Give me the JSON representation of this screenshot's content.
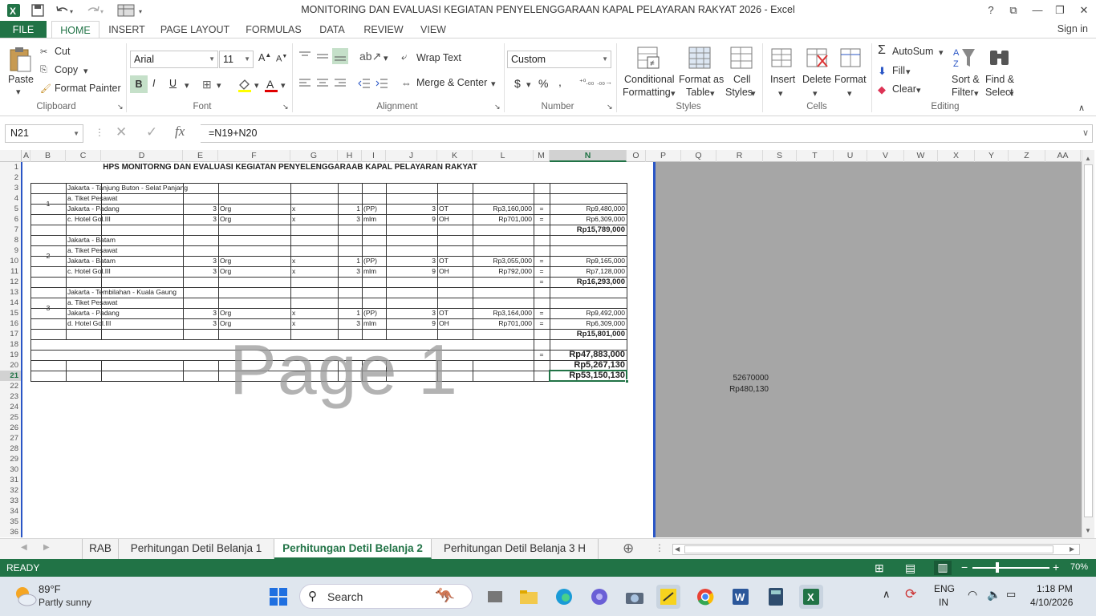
{
  "window": {
    "title": "MONITORING DAN EVALUASI KEGIATAN PENYELENGGARAAN KAPAL PELAYARAN RAKYAT 2026 - Excel",
    "help": "?",
    "signin": "Sign in"
  },
  "ribbon_tabs": [
    "FILE",
    "HOME",
    "INSERT",
    "PAGE LAYOUT",
    "FORMULAS",
    "DATA",
    "REVIEW",
    "VIEW"
  ],
  "ribbon": {
    "clipboard": {
      "paste": "Paste",
      "cut": "Cut",
      "copy": "Copy",
      "format_painter": "Format Painter",
      "label": "Clipboard"
    },
    "font": {
      "name": "Arial",
      "size": "11",
      "bold": "B",
      "italic": "I",
      "underline": "U",
      "label": "Font"
    },
    "alignment": {
      "wrap": "Wrap Text",
      "merge": "Merge & Center",
      "label": "Alignment"
    },
    "number": {
      "format": "Custom",
      "currency": "$",
      "percent": "%",
      "comma": ",",
      "label": "Number"
    },
    "styles": {
      "conditional_1": "Conditional",
      "conditional_2": "Formatting",
      "format_table_1": "Format as",
      "format_table_2": "Table",
      "cell_styles_1": "Cell",
      "cell_styles_2": "Styles",
      "label": "Styles"
    },
    "cells": {
      "insert": "Insert",
      "delete": "Delete",
      "format": "Format",
      "label": "Cells"
    },
    "editing": {
      "autosum": "AutoSum",
      "fill": "Fill",
      "clear": "Clear",
      "sort_1": "Sort &",
      "sort_2": "Filter",
      "find_1": "Find &",
      "find_2": "Select",
      "label": "Editing"
    }
  },
  "formula_bar": {
    "name_box": "N21",
    "fx": "fx",
    "formula": "=N19+N20"
  },
  "columns": [
    "A",
    "B",
    "C",
    "D",
    "E",
    "F",
    "G",
    "H",
    "I",
    "J",
    "K",
    "L",
    "M",
    "N",
    "O",
    "P",
    "Q",
    "R",
    "S",
    "T",
    "U",
    "V",
    "W",
    "X",
    "Y",
    "Z",
    "AA"
  ],
  "rows": [
    "1",
    "2",
    "3",
    "4",
    "5",
    "6",
    "7",
    "8",
    "9",
    "10",
    "11",
    "12",
    "13",
    "14",
    "15",
    "16",
    "17",
    "18",
    "19",
    "20",
    "21",
    "22",
    "23",
    "24",
    "25",
    "26",
    "27",
    "28",
    "29",
    "30",
    "31",
    "32",
    "33",
    "34",
    "35",
    "36"
  ],
  "sheet": {
    "heading": "HPS  MONITORNG DAN EVALUASI KEGIATAN PENYELENGGARAAB KAPAL PELAYARAN RAKYAT",
    "watermark": "Page 1",
    "groups": [
      {
        "no": "1",
        "route": "Jakarta - Tanjung Buton - Selat Panjang",
        "ticket_label": "a. Tiket Pesawat",
        "line1": {
          "desc": "Jakarta - Padang",
          "qty": "3",
          "unit": "Org",
          "x": "x",
          "n": "1",
          "n_unit": "(PP)",
          "total": "3",
          "t_unit": "OT",
          "price": "Rp3,160,000",
          "eq": "=",
          "amount": "Rp9,480,000"
        },
        "line2": {
          "desc": "c. Hotel Gol.III",
          "qty": "3",
          "unit": "Org",
          "x": "x",
          "n": "3",
          "n_unit": "mlm",
          "total": "9",
          "t_unit": "OH",
          "price": "Rp701,000",
          "eq": "=",
          "amount": "Rp6,309,000"
        },
        "subtotal": "Rp15,789,000",
        "subtotal_eq": ""
      },
      {
        "no": "2",
        "route": "Jakarta - Batam",
        "ticket_label": "a. Tiket Pesawat",
        "line1": {
          "desc": "Jakarta - Batam",
          "qty": "3",
          "unit": "Org",
          "x": "x",
          "n": "1",
          "n_unit": "(PP)",
          "total": "3",
          "t_unit": "OT",
          "price": "Rp3,055,000",
          "eq": "=",
          "amount": "Rp9,165,000"
        },
        "line2": {
          "desc": "c. Hotel Gol.III",
          "qty": "3",
          "unit": "Org",
          "x": "x",
          "n": "3",
          "n_unit": "mlm",
          "total": "9",
          "t_unit": "OH",
          "price": "Rp792,000",
          "eq": "=",
          "amount": "Rp7,128,000"
        },
        "subtotal": "Rp16,293,000",
        "subtotal_eq": "="
      },
      {
        "no": "3",
        "route": "Jakarta - Tembilahan - Kuala Gaung",
        "ticket_label": "a. Tiket Pesawat",
        "line1": {
          "desc": "Jakarta - Padang",
          "qty": "3",
          "unit": "Org",
          "x": "x",
          "n": "1",
          "n_unit": "(PP)",
          "total": "3",
          "t_unit": "OT",
          "price": "Rp3,164,000",
          "eq": "=",
          "amount": "Rp9,492,000"
        },
        "line2": {
          "desc": "d. Hotel Gol.III",
          "qty": "3",
          "unit": "Org",
          "x": "x",
          "n": "3",
          "n_unit": "mlm",
          "total": "9",
          "t_unit": "OH",
          "price": "Rp701,000",
          "eq": "=",
          "amount": "Rp6,309,000"
        },
        "subtotal": "Rp15,801,000",
        "subtotal_eq": ""
      }
    ],
    "total_eq": "=",
    "total": "Rp47,883,000",
    "tax": "Rp5,267,130",
    "grand_total": "Rp53,150,130",
    "side_value_1": "52670000",
    "side_value_2": "Rp480,130"
  },
  "sheet_tabs": [
    "RAB",
    "Perhitungan Detil Belanja 1",
    "Perhitungan Detil Belanja 2",
    "Perhitungan Detil Belanja 3 H"
  ],
  "status": {
    "mode": "READY",
    "zoom": "70%"
  },
  "taskbar": {
    "weather_temp": "89°F",
    "weather_desc": "Partly sunny",
    "search": "Search",
    "lang_1": "ENG",
    "lang_2": "IN",
    "time": "1:18 PM",
    "date": "4/10/2026"
  },
  "colors": {
    "excel_green": "#217346",
    "page_break": "#2a56c6",
    "gray_pane": "#a6a6a6"
  }
}
